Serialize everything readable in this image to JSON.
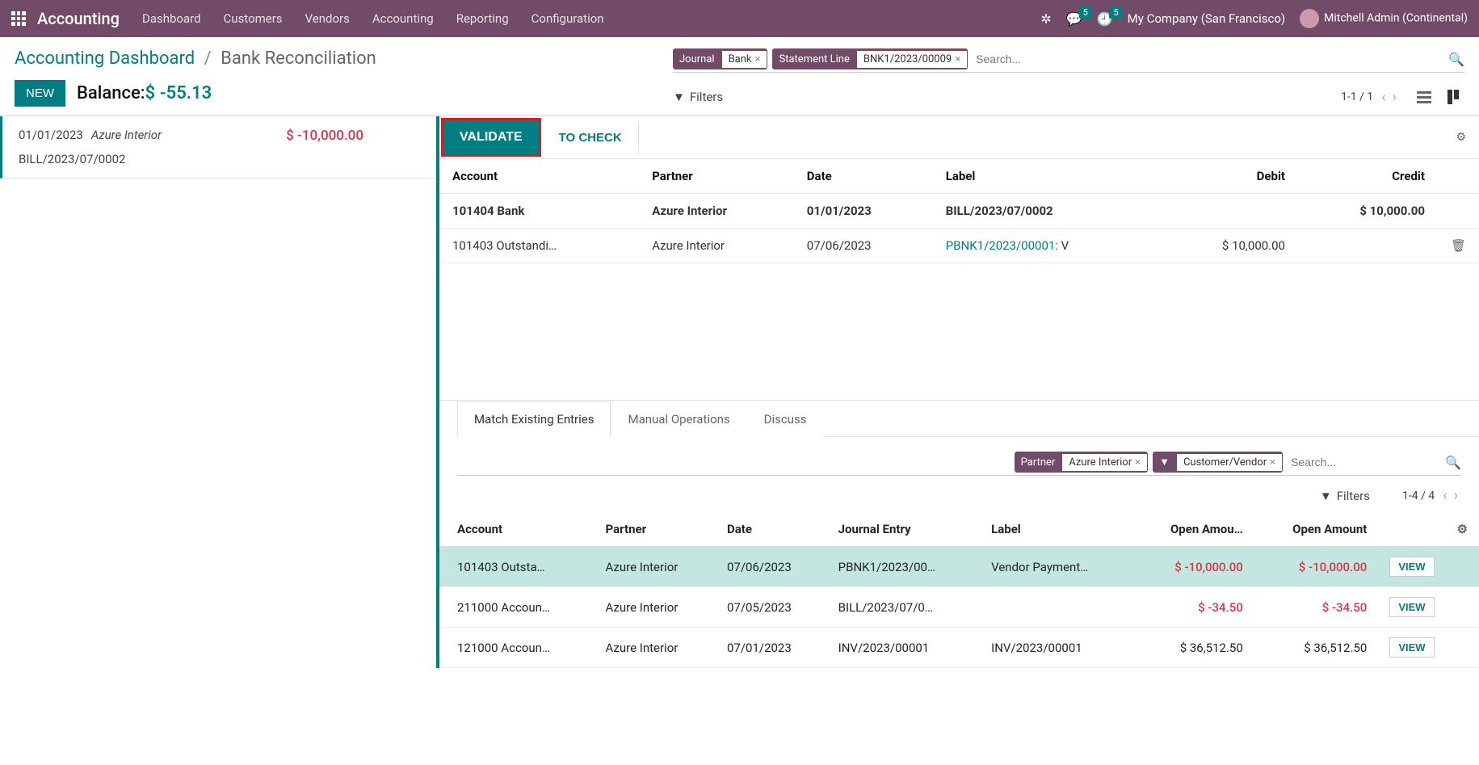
{
  "navbar": {
    "brand": "Accounting",
    "menu": [
      "Dashboard",
      "Customers",
      "Vendors",
      "Accounting",
      "Reporting",
      "Configuration"
    ],
    "msg_badge": "5",
    "activity_badge": "5",
    "company": "My Company (San Francisco)",
    "user": "Mitchell Admin (Continental)"
  },
  "breadcrumb": {
    "parent": "Accounting Dashboard",
    "current": "Bank Reconciliation"
  },
  "controls": {
    "new_btn": "NEW",
    "balance_label": "Balance:",
    "balance_value": "$ -55.13",
    "filters": "Filters",
    "pager": "1-1 / 1"
  },
  "search": {
    "facets": [
      {
        "label": "Journal",
        "value": "Bank"
      },
      {
        "label": "Statement Line",
        "value": "BNK1/2023/00009"
      }
    ],
    "placeholder": "Search..."
  },
  "statement": {
    "date": "01/01/2023",
    "partner": "Azure Interior",
    "amount": "$ -10,000.00",
    "ref": "BILL/2023/07/0002"
  },
  "statusbar": {
    "validate": "VALIDATE",
    "to_check": "TO CHECK"
  },
  "lines": {
    "headers": {
      "account": "Account",
      "partner": "Partner",
      "date": "Date",
      "label": "Label",
      "debit": "Debit",
      "credit": "Credit"
    },
    "bank": {
      "account": "101404 Bank",
      "partner": "Azure Interior",
      "date": "01/01/2023",
      "label": "BILL/2023/07/0002",
      "debit": "",
      "credit": "$ 10,000.00"
    },
    "suspense": {
      "account": "101403 Outstandi…",
      "partner": "Azure Interior",
      "date": "07/06/2023",
      "label_link": "PBNK1/2023/00001:",
      "label_tail": " V",
      "debit": "$ 10,000.00",
      "credit": ""
    }
  },
  "tabs": {
    "match": "Match Existing Entries",
    "manual": "Manual Operations",
    "discuss": "Discuss"
  },
  "sub_search": {
    "partner_label": "Partner",
    "partner_value": "Azure Interior",
    "filter_value": "Customer/Vendor",
    "placeholder": "Search...",
    "filters": "Filters",
    "pager": "1-4 / 4"
  },
  "match": {
    "headers": {
      "account": "Account",
      "partner": "Partner",
      "date": "Date",
      "journal": "Journal Entry",
      "label": "Label",
      "open1": "Open Amou…",
      "open2": "Open Amount"
    },
    "rows": [
      {
        "account": "101403 Outsta…",
        "partner": "Azure Interior",
        "date": "07/06/2023",
        "journal": "PBNK1/2023/00…",
        "label": "Vendor Payment…",
        "open1": "$ -10,000.00",
        "open2": "$ -10,000.00",
        "neg": true,
        "selected": true,
        "view": "VIEW"
      },
      {
        "account": "211000 Accoun…",
        "partner": "Azure Interior",
        "date": "07/05/2023",
        "journal": "BILL/2023/07/0…",
        "label": "",
        "open1": "$ -34.50",
        "open2": "$ -34.50",
        "neg": true,
        "selected": false,
        "view": "VIEW"
      },
      {
        "account": "121000 Accoun…",
        "partner": "Azure Interior",
        "date": "07/01/2023",
        "journal": "INV/2023/00001",
        "label": "INV/2023/00001",
        "open1": "$ 36,512.50",
        "open2": "$ 36,512.50",
        "neg": false,
        "selected": false,
        "view": "VIEW"
      }
    ]
  }
}
